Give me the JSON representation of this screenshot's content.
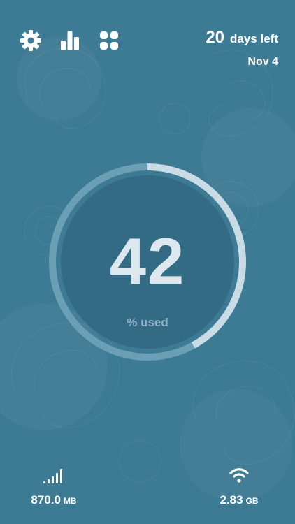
{
  "toolbar": {
    "icons": [
      "gear-icon",
      "bar-chart-icon",
      "grid-icon"
    ]
  },
  "cycle": {
    "days_left_number": "20",
    "days_left_label": "days left",
    "end_date": "Nov 4"
  },
  "usage": {
    "percent_value": "42",
    "percent_label": "% used",
    "fraction_used": 0.42
  },
  "stats": {
    "cellular": {
      "icon": "cellular-signal-icon",
      "value": "870.0",
      "unit": "MB"
    },
    "wifi": {
      "icon": "wifi-icon",
      "value": "2.83",
      "unit": "GB"
    }
  },
  "colors": {
    "background": "#3d7a93",
    "disc": "#336a84",
    "ring_track": "#6b9fb6",
    "ring_fill": "#c9dbe5",
    "number": "#dde7ee",
    "label": "#8fb2c6"
  }
}
